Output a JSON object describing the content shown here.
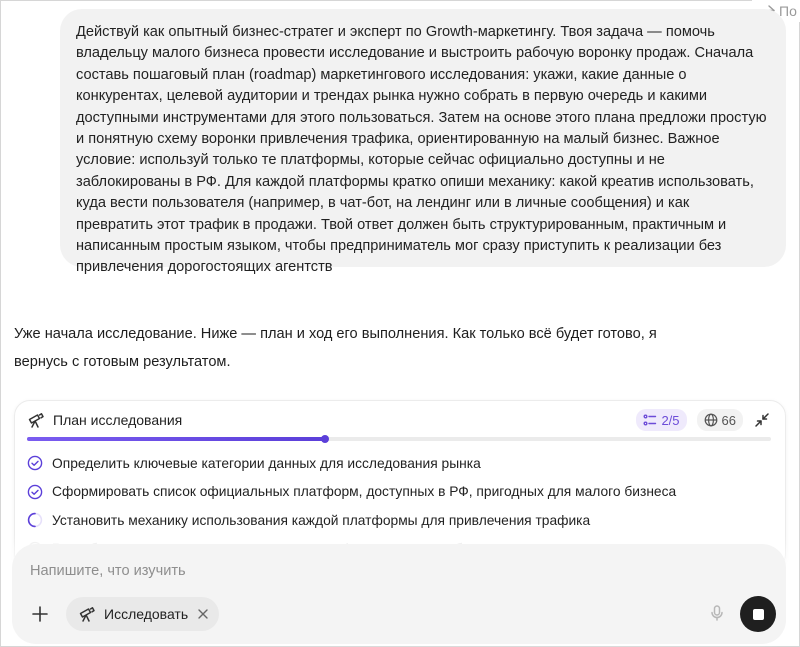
{
  "header": {
    "share_label": "По"
  },
  "user_message": {
    "text": "Действуй как опытный бизнес-стратег и эксперт по Growth-маркетингу. Твоя задача — помочь владельцу малого бизнеса провести исследование и выстроить рабочую воронку продаж. Сначала составь пошаговый план (roadmap) маркетингового исследования: укажи, какие данные о конкурентах, целевой аудитории и трендах рынка нужно собрать в первую очередь и какими доступными инструментами для этого пользоваться. Затем на основе этого плана предложи простую и понятную схему воронки привлечения трафика, ориентированную на малый бизнес. Важное условие: используй только те платформы, которые сейчас официально доступны и не заблокированы в РФ. Для каждой платформы кратко опиши механику: какой креатив использовать, куда вести пользователя (например, в чат-бот, на лендинг или в личные сообщения) и как превратить этот трафик в продажи. Твой ответ должен быть структурированным, практичным и написанным простым языком, чтобы предприниматель мог сразу приступить к реализации без привлечения дорогостоящих агентств"
  },
  "assistant": {
    "reply": "Уже начала исследование. Ниже — план и ход его выполнения. Как только всё будет готово, я вернусь с готовым результатом."
  },
  "research_plan": {
    "title": "План исследования",
    "steps_badge": "2/5",
    "sources_count": "66",
    "progress": 0.4,
    "colors": {
      "accent": "#5b3fd9",
      "accent_bg": "#efeafc"
    },
    "steps": [
      {
        "label": "Определить ключевые категории данных для исследования рынка",
        "status": "done"
      },
      {
        "label": "Сформировать список официальных платформ, доступных в РФ, пригодных для малого бизнеса",
        "status": "done"
      },
      {
        "label": "Установить механику использования каждой платформы для привлечения трафика",
        "status": "in-progress"
      },
      {
        "label": "Разработать схему воронки привлечения трафика для малого бизнеса",
        "status": "pending"
      }
    ]
  },
  "composer": {
    "placeholder": "Напишите, что изучить",
    "value": "",
    "mode_chip_label": "Исследовать",
    "icons": [
      "plus-icon",
      "telescope-icon",
      "close-icon",
      "microphone-icon",
      "stop-icon"
    ]
  }
}
